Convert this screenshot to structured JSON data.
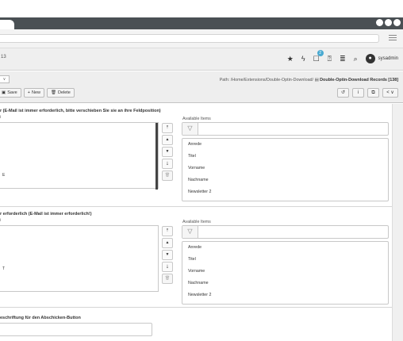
{
  "browser": {
    "menu_icon": "hamburger-icon"
  },
  "topbar": {
    "version": "13",
    "notification_count": "2",
    "username": "sysadmin"
  },
  "docheader": {
    "lang_select": "∨",
    "path_prefix": "Path: /Home/Extensions/Double-Optin-Download/",
    "path_current": "Double-Optin-Download Records [138]",
    "buttons": {
      "save": "Save",
      "new": "New",
      "delete": "Delete"
    }
  },
  "sections": [
    {
      "label": "r (E-Mail ist immer erforderlich, bitte verschieben Sie sie an ihre Feldposition)",
      "sub": "i",
      "selected_cursor": "E",
      "available_label": "Available Items",
      "available_items": [
        "Anrede",
        "Titel",
        "Vorname",
        "Nachname",
        "Newsletter 2"
      ]
    },
    {
      "label": "r erforderlich (E-Mail ist immer erforderlich!)",
      "sub": "i",
      "selected_cursor": "T",
      "available_label": "Available Items",
      "available_items": [
        "Anrede",
        "Titel",
        "Vorname",
        "Nachname",
        "Newsletter 2"
      ]
    }
  ],
  "submit_section": {
    "label": "eschriftung für den Abschicken-Button",
    "value": ""
  }
}
